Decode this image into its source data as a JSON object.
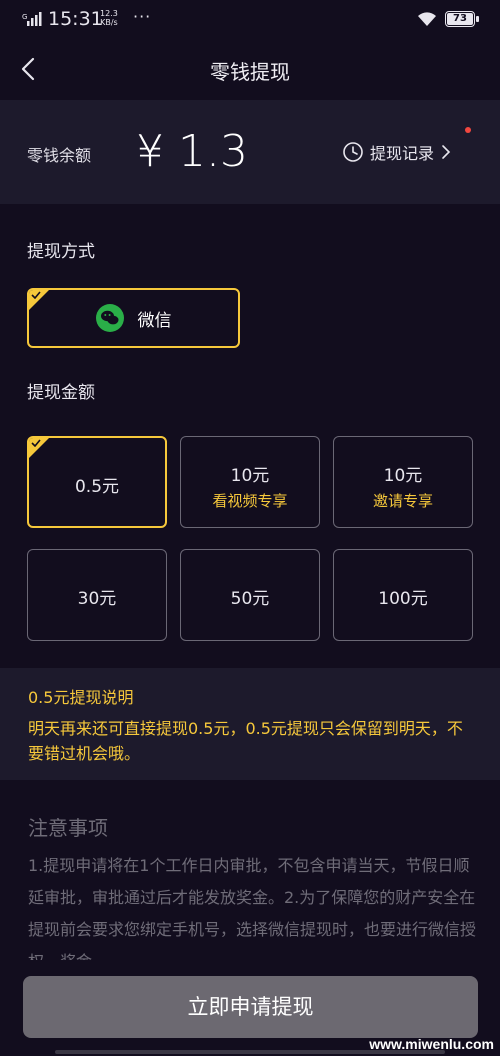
{
  "status_bar": {
    "network": "G",
    "time": "15:31",
    "speed_value": "12.3",
    "speed_unit": "KB/s",
    "dots": "···",
    "battery": "73"
  },
  "nav": {
    "title": "零钱提现",
    "back_icon": "chevron-left-icon"
  },
  "balance": {
    "label": "零钱余额",
    "value": "¥ 1.3",
    "record_label": "提现记录"
  },
  "method": {
    "section_title": "提现方式",
    "option_label": "微信"
  },
  "amount": {
    "section_title": "提现金额",
    "options": [
      {
        "amount": "0.5元",
        "sub": ""
      },
      {
        "amount": "10元",
        "sub": "看视频专享"
      },
      {
        "amount": "10元",
        "sub": "邀请专享"
      },
      {
        "amount": "30元",
        "sub": ""
      },
      {
        "amount": "50元",
        "sub": ""
      },
      {
        "amount": "100元",
        "sub": ""
      }
    ]
  },
  "explanation": {
    "title": "0.5元提现说明",
    "body": "明天再来还可直接提现0.5元，0.5元提现只会保留到明天，不要错过机会哦。"
  },
  "notice": {
    "title": "注意事项",
    "body": "1.提现申请将在1个工作日内审批，不包含申请当天，节假日顺延审批，审批通过后才能发放奖金。2.为了保障您的财产安全在提现前会要求您绑定手机号，选择微信提现时，也要进行微信授权，奖金"
  },
  "action": {
    "apply_label": "立即申请提现"
  },
  "watermark": "www.miwenlu.com",
  "colors": {
    "background": "#120d1e",
    "card": "#1d1a2c",
    "accent": "#f6c83b",
    "button": "#6c6971",
    "wechat": "#2aae48"
  }
}
